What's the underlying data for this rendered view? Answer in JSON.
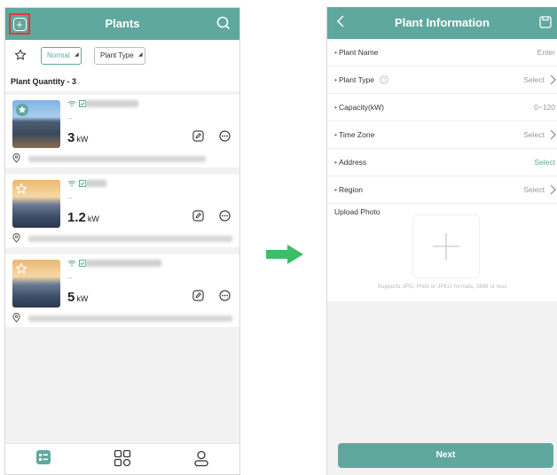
{
  "plants_screen": {
    "title": "Plants",
    "filters": {
      "status": "Normal",
      "type": "Plant Type"
    },
    "quantity_label": "Plant Quantity - 3",
    "plants": [
      {
        "power": "3",
        "unit": "kW",
        "status": "--"
      },
      {
        "power": "1.2",
        "unit": "kW",
        "status": "--"
      },
      {
        "power": "5",
        "unit": "kW",
        "status": "--"
      }
    ],
    "tabs": [
      {
        "icon": "plant-list-icon"
      },
      {
        "icon": "apps-grid-icon"
      },
      {
        "icon": "user-icon"
      }
    ]
  },
  "info_screen": {
    "title": "Plant Information",
    "fields": [
      {
        "label": "Plant Name",
        "value": "Enter"
      },
      {
        "label": "Plant Type",
        "value": "Select"
      },
      {
        "label": "Capacity(kW)",
        "value": "0~120"
      },
      {
        "label": "Time Zone",
        "value": "Select"
      },
      {
        "label": "Address",
        "value": "Select"
      },
      {
        "label": "Region",
        "value": "Select"
      }
    ],
    "upload_label": "Upload Photo",
    "upload_hint": "Supports JPG, PNG or JPEG formats, 5MB or less",
    "next_label": "Next"
  },
  "colors": {
    "accent": "#5fa89d",
    "required": "#e0373c",
    "arrow": "#3dbd6a"
  }
}
